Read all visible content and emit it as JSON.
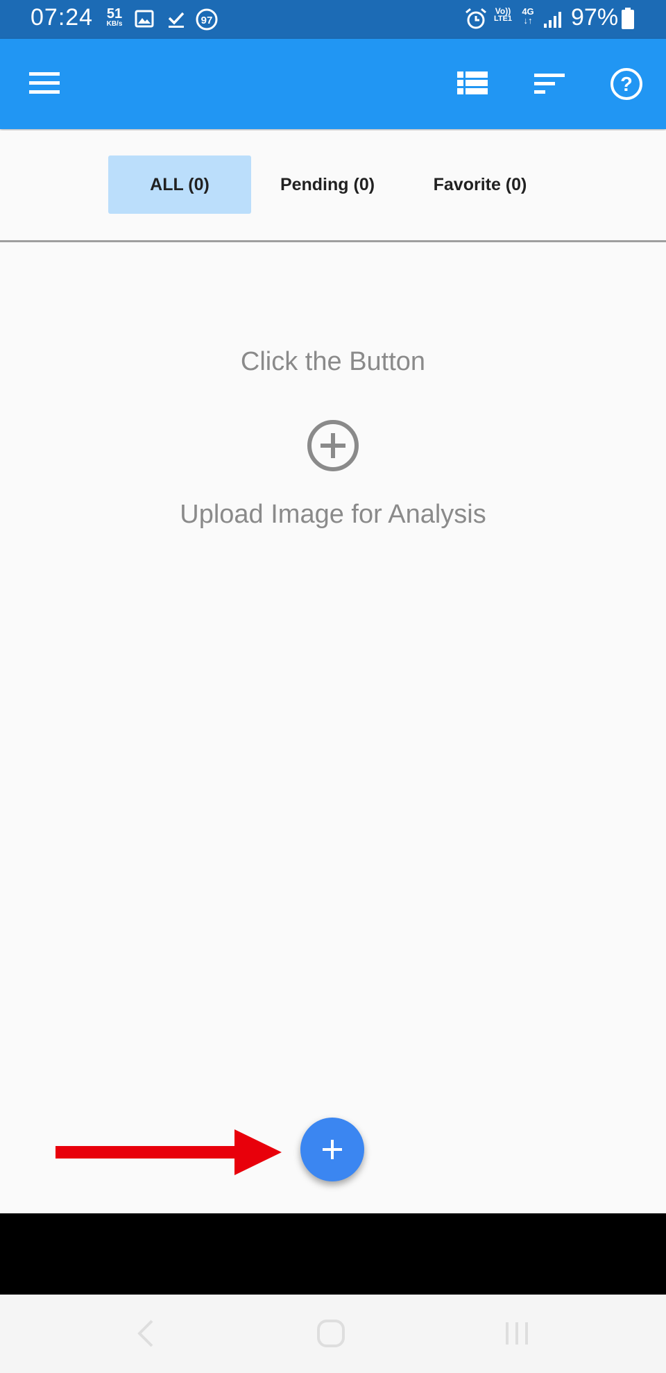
{
  "status_bar": {
    "time": "07:24",
    "net_speed_value": "51",
    "net_speed_unit": "KB/s",
    "badge": "97",
    "volte_top": "Vo))",
    "volte_bottom": "LTE1",
    "net_type": "4G",
    "battery_pct": "97%"
  },
  "app_bar": {
    "icons": [
      "menu-icon",
      "list-view-icon",
      "sort-icon",
      "help-icon"
    ]
  },
  "tabs": [
    {
      "label": "ALL (0)",
      "selected": true
    },
    {
      "label": "Pending (0)",
      "selected": false
    },
    {
      "label": "Favorite (0)",
      "selected": false
    }
  ],
  "empty_state": {
    "title": "Click the Button",
    "subtitle": "Upload Image for Analysis"
  },
  "colors": {
    "status_bar": "#1c6bb5",
    "app_bar": "#2196f3",
    "selected_tab": "#bbdefb",
    "fab": "#3b86f1",
    "arrow": "#e8000b"
  }
}
